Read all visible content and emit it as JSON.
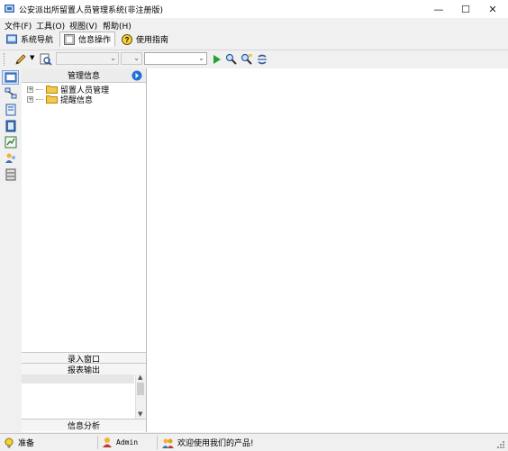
{
  "window": {
    "title": "公安派出所留置人员管理系统(非注册版)",
    "controls": {
      "minimize": "—",
      "maximize": "☐",
      "close": "✕"
    }
  },
  "menu": [
    "文件(F)",
    "工具(O)",
    "视图(V)",
    "帮助(H)"
  ],
  "tabs": [
    {
      "label": "系统导航",
      "icon": "navigation-icon"
    },
    {
      "label": "信息操作",
      "icon": "info-operation-icon",
      "active": true
    },
    {
      "label": "使用指南",
      "icon": "help-icon"
    }
  ],
  "toolbar": {
    "combo1_value": "",
    "combo2_value": "",
    "combo3_value": ""
  },
  "panel": {
    "header": "管理信息",
    "tree": [
      {
        "label": "留置人员管理",
        "expander": "+"
      },
      {
        "label": "提醒信息",
        "expander": "+"
      }
    ],
    "sections": {
      "entry": "录入窗口",
      "report": "报表输出",
      "analysis": "信息分析"
    }
  },
  "statusbar": {
    "status": "准备",
    "user": "Admin",
    "message": "欢迎使用我们的产品!"
  },
  "colors": {
    "window_bg": "#f0f0f0",
    "content_bg": "#ffffff",
    "accent_blue": "#1e6fd9",
    "folder_yellow": "#f2c94c",
    "go_green": "#22a32a"
  }
}
